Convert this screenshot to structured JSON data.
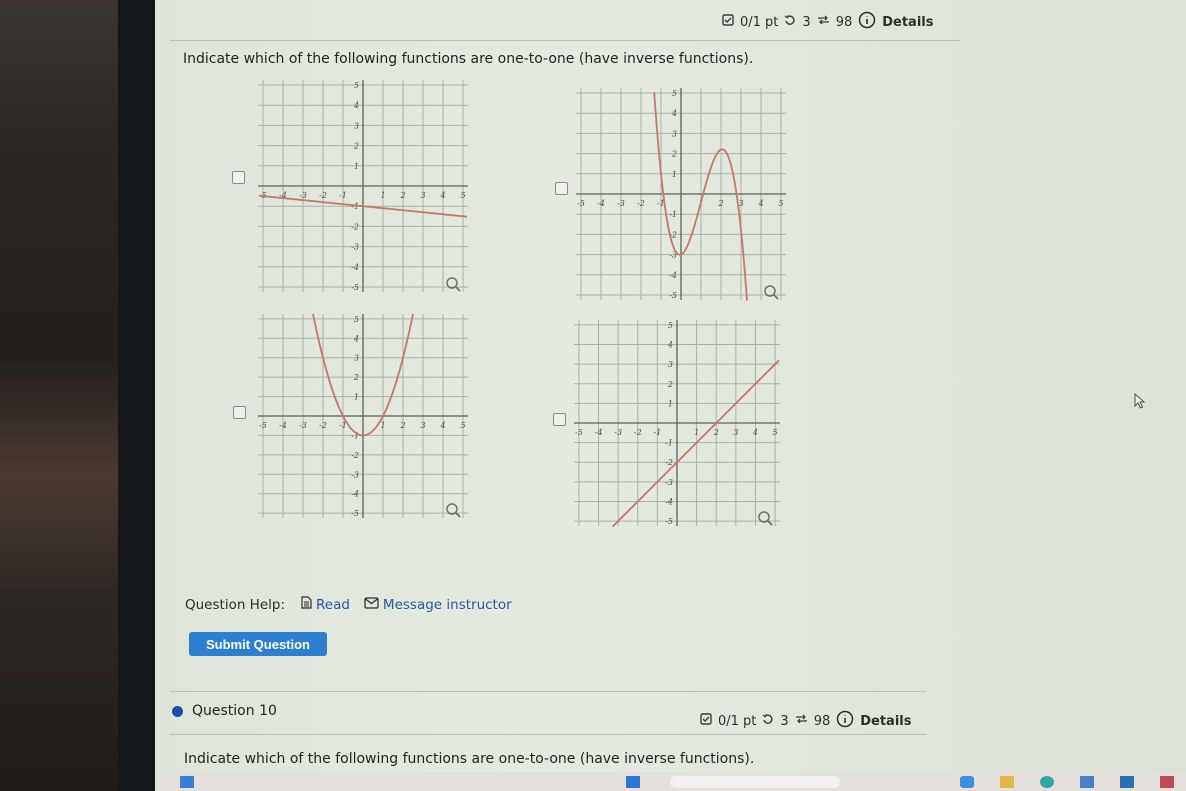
{
  "question9": {
    "meta": {
      "score": "0/1 pt",
      "retries": "3",
      "attempts": "98",
      "details_label": "Details"
    },
    "prompt": "Indicate which of the following functions are one-to-one (have inverse functions).",
    "graphs": [
      {
        "id": "graph-1",
        "description": "decreasing line",
        "checked": false,
        "function": "y = -0.1x - 1",
        "points": [
          [
            -5,
            -0.5
          ],
          [
            0,
            -1
          ],
          [
            5,
            -1.5
          ]
        ]
      },
      {
        "id": "graph-2",
        "description": "cubic with local min (0,-3) and local max (2.2,3)",
        "checked": false,
        "points": [
          [
            -1.2,
            5
          ],
          [
            -1,
            0
          ],
          [
            0,
            -3
          ],
          [
            1,
            0
          ],
          [
            2.2,
            3
          ],
          [
            3,
            0
          ],
          [
            3.3,
            -5
          ]
        ]
      },
      {
        "id": "graph-3",
        "description": "parabola vertex (0,-1)",
        "checked": false,
        "function": "y = x^2 - 1"
      },
      {
        "id": "graph-4",
        "description": "increasing line",
        "checked": false,
        "function": "y = x - 2"
      }
    ],
    "axis": {
      "x_ticks": [
        "-5",
        "-4",
        "-3",
        "-2",
        "-1",
        "1",
        "2",
        "3",
        "4",
        "5"
      ],
      "y_ticks": [
        "5",
        "4",
        "3",
        "2",
        "1",
        "-1",
        "-2",
        "-3",
        "-4",
        "-5"
      ]
    },
    "help_label": "Question Help:",
    "read_label": "Read",
    "message_label": "Message instructor",
    "submit_label": "Submit Question"
  },
  "question10": {
    "title": "Question 10",
    "meta": {
      "score": "0/1 pt",
      "retries": "3",
      "attempts": "98",
      "details_label": "Details"
    },
    "prompt": "Indicate which of the following functions are one-to-one (have inverse functions)."
  },
  "colors": {
    "curve": "#c4776a",
    "grid": "#a9b3a4",
    "link": "#2a56a8",
    "button": "#2d7fcf",
    "status_dot": "#1f4fa3"
  }
}
